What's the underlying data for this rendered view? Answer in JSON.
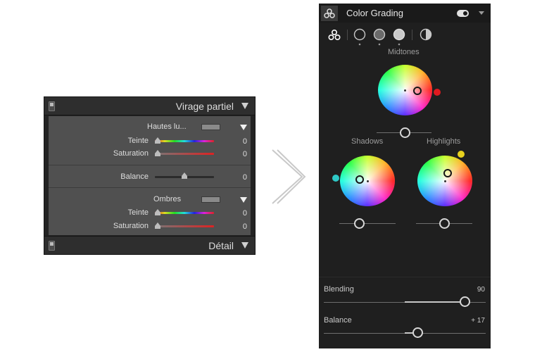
{
  "old_panel": {
    "title": "Virage partiel",
    "footer_title": "Détail",
    "highlights": {
      "label": "Hautes lu...",
      "hue_label": "Teinte",
      "hue_value": "0",
      "saturation_label": "Saturation",
      "saturation_value": "0"
    },
    "balance": {
      "label": "Balance",
      "value": "0"
    },
    "shadows": {
      "label": "Ombres",
      "hue_label": "Teinte",
      "hue_value": "0",
      "saturation_label": "Saturation",
      "saturation_value": "0"
    }
  },
  "new_panel": {
    "title": "Color Grading",
    "midtones_label": "Midtones",
    "shadows_label": "Shadows",
    "highlights_label": "Highlights",
    "blending_label": "Blending",
    "blending_value": "90",
    "balance_label": "Balance",
    "balance_value": "+ 17",
    "colors": {
      "midtones_dot": "#e0191f",
      "shadows_dot": "#2ec8c6",
      "highlights_dot": "#e8d21e"
    }
  }
}
